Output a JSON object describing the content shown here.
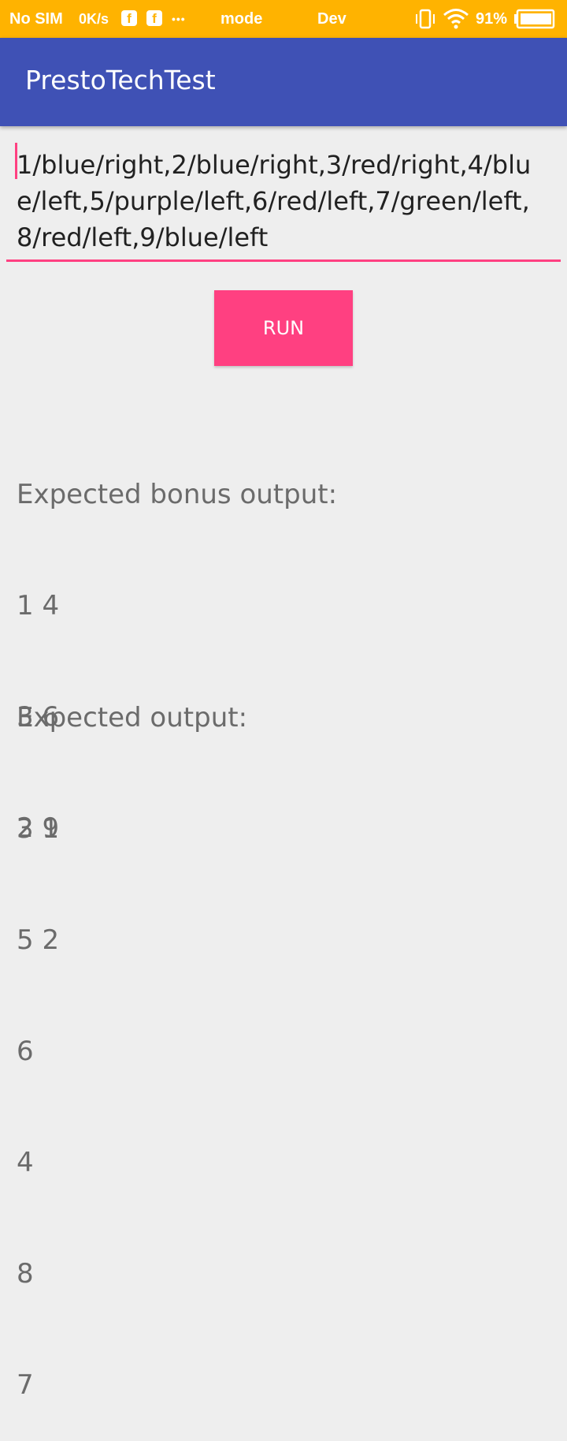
{
  "status_bar": {
    "carrier": "No SIM",
    "speed": "0K/s",
    "notif_1": "f",
    "notif_2": "f",
    "more": "•••",
    "mode_text": "mode",
    "dev_text": "Dev",
    "battery": "91%",
    "color": "#ffb300"
  },
  "app_bar": {
    "title": "PrestoTechTest",
    "color": "#3f51b5"
  },
  "input": {
    "value": "1/blue/right,2/blue/right,3/red/right,4/blue/left,5/purple/left,6/red/left,7/green/left,8/red/left,9/blue/left",
    "accent": "#ff4081"
  },
  "run_button": {
    "label": "RUN"
  },
  "bonus_output": {
    "heading": "Expected bonus output:",
    "lines": [
      "1 4",
      "3 6",
      "2 9"
    ]
  },
  "expected_output": {
    "heading": "Expected output:",
    "lines": [
      "3 1",
      "5 2",
      "6",
      "4",
      "8",
      "7"
    ]
  }
}
